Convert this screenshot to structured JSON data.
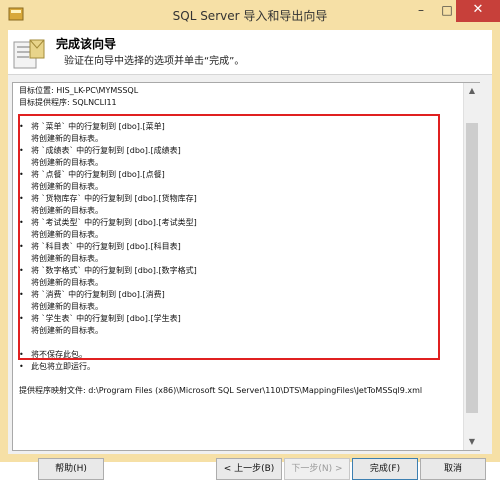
{
  "window": {
    "title": "SQL Server 导入和导出向导"
  },
  "header": {
    "title": "完成该向导",
    "subtitle": "验证在向导中选择的选项并单击“完成”。"
  },
  "summary": {
    "target": "目标位置: HIS_LK-PC\\MYMSSQL",
    "provider": "目标提供程序: SQLNCLI11",
    "copy_items": [
      {
        "line1": "将 `菜单` 中的行复制到 [dbo].[菜单]",
        "line2": "将创建新的目标表。"
      },
      {
        "line1": "将 `成绩表` 中的行复制到 [dbo].[成绩表]",
        "line2": "将创建新的目标表。"
      },
      {
        "line1": "将 `点餐` 中的行复制到 [dbo].[点餐]",
        "line2": "将创建新的目标表。"
      },
      {
        "line1": "将 `货物库存` 中的行复制到 [dbo].[货物库存]",
        "line2": "将创建新的目标表。"
      },
      {
        "line1": "将 `考试类型` 中的行复制到 [dbo].[考试类型]",
        "line2": "将创建新的目标表。"
      },
      {
        "line1": "将 `科目表` 中的行复制到 [dbo].[科目表]",
        "line2": "将创建新的目标表。"
      },
      {
        "line1": "将 `数字格式` 中的行复制到 [dbo].[数字格式]",
        "line2": "将创建新的目标表。"
      },
      {
        "line1": "将 `消费` 中的行复制到 [dbo].[消费]",
        "line2": "将创建新的目标表。"
      },
      {
        "line1": "将 `学生表` 中的行复制到 [dbo].[学生表]",
        "line2": "将创建新的目标表。"
      }
    ],
    "notes": [
      "将不保存此包。",
      "此包将立即运行。"
    ],
    "mapping_file": "提供程序映射文件: d:\\Program Files (x86)\\Microsoft SQL Server\\110\\DTS\\MappingFiles\\JetToMSSql9.xml"
  },
  "buttons": {
    "help": "帮助(H)",
    "back": "< 上一步(B)",
    "next": "下一步(N) >",
    "finish": "完成(F)",
    "cancel": "取消"
  },
  "colors": {
    "titlebar": "#f6e0a6",
    "close": "#c7403a",
    "highlight": "#e02020"
  },
  "icons": [
    "app-icon",
    "minimize-icon",
    "maximize-icon",
    "close-icon",
    "wizard-icon"
  ]
}
